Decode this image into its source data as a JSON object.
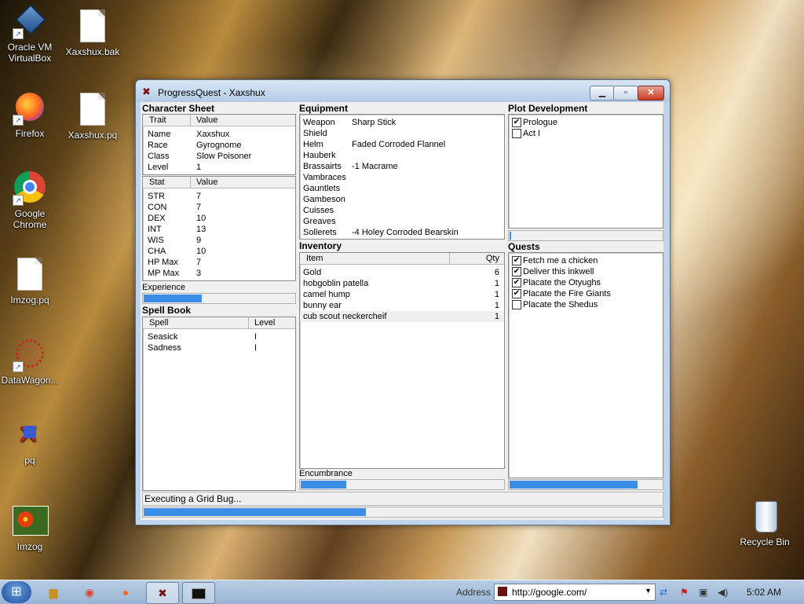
{
  "desktop": {
    "icons": [
      {
        "label": "Oracle VM VirtualBox",
        "line2": ""
      },
      {
        "label": "Xaxshux.bak"
      },
      {
        "label": "Firefox"
      },
      {
        "label": "Xaxshux.pq"
      },
      {
        "label": "Google Chrome"
      },
      {
        "label": "Imzog.pq"
      },
      {
        "label": "DataWagon..."
      },
      {
        "label": "pq"
      },
      {
        "label": "Imzog"
      },
      {
        "label": "Recycle Bin"
      }
    ]
  },
  "window": {
    "title": "ProgressQuest - Xaxshux",
    "character_sheet": {
      "title": "Character Sheet",
      "headers": [
        "Trait",
        "Value"
      ],
      "rows": [
        [
          "Name",
          "Xaxshux"
        ],
        [
          "Race",
          "Gyrognome"
        ],
        [
          "Class",
          "Slow Poisoner"
        ],
        [
          "Level",
          "1"
        ]
      ],
      "stat_headers": [
        "Stat",
        "Value"
      ],
      "stats": [
        [
          "STR",
          "7"
        ],
        [
          "CON",
          "7"
        ],
        [
          "DEX",
          "10"
        ],
        [
          "INT",
          "13"
        ],
        [
          "WIS",
          "9"
        ],
        [
          "CHA",
          "10"
        ],
        [
          "HP Max",
          "7"
        ],
        [
          "MP Max",
          "3"
        ]
      ],
      "experience_label": "Experience",
      "experience_progress": 0.39
    },
    "spell_book": {
      "title": "Spell Book",
      "headers": [
        "Spell",
        "Level"
      ],
      "rows": [
        [
          "Seasick",
          "I"
        ],
        [
          "Sadness",
          "I"
        ]
      ]
    },
    "equipment": {
      "title": "Equipment",
      "rows": [
        [
          "Weapon",
          "Sharp Stick"
        ],
        [
          "Shield",
          ""
        ],
        [
          "Helm",
          "Faded Corroded Flannel"
        ],
        [
          "Hauberk",
          ""
        ],
        [
          "Brassairts",
          "-1 Macrame"
        ],
        [
          "Vambraces",
          ""
        ],
        [
          "Gauntlets",
          ""
        ],
        [
          "Gambeson",
          ""
        ],
        [
          "Cuisses",
          ""
        ],
        [
          "Greaves",
          ""
        ],
        [
          "Sollerets",
          "-4 Holey Corroded Bearskin"
        ]
      ]
    },
    "inventory": {
      "title": "Inventory",
      "headers": [
        "Item",
        "Qty"
      ],
      "rows": [
        [
          "Gold",
          "6"
        ],
        [
          "hobgoblin patella",
          "1"
        ],
        [
          "camel hump",
          "1"
        ],
        [
          "bunny ear",
          "1"
        ],
        [
          "cub scout neckercheif",
          "1"
        ]
      ],
      "encumbrance_label": "Encumbrance",
      "encumbrance_progress": 0.23
    },
    "plot": {
      "title": "Plot Development",
      "items": [
        {
          "label": "Prologue",
          "checked": true
        },
        {
          "label": "Act I",
          "checked": false
        }
      ],
      "progress": 0.02
    },
    "quests": {
      "title": "Quests",
      "items": [
        {
          "label": "Fetch me a chicken",
          "checked": true
        },
        {
          "label": "Deliver this inkwell",
          "checked": true
        },
        {
          "label": "Placate the Otyughs",
          "checked": true
        },
        {
          "label": "Placate the Fire Giants",
          "checked": true
        },
        {
          "label": "Placate the Shedus",
          "checked": false
        }
      ],
      "progress": 0.84
    },
    "status": {
      "text": "Executing a Grid Bug...",
      "progress": 0.43
    }
  },
  "taskbar": {
    "address_label": "Address",
    "address_value": "http://google.com/",
    "clock": "5:02 AM"
  }
}
